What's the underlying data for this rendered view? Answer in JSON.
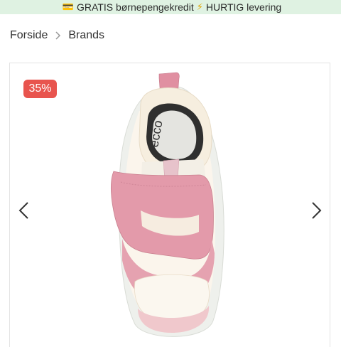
{
  "promo": {
    "card_icon": "💳",
    "text1": "GRATIS børnepengekredit",
    "bolt_icon": "⚡",
    "text2": "HURTIG levering"
  },
  "breadcrumb": {
    "items": [
      {
        "label": "Forside"
      },
      {
        "label": "Brands"
      }
    ]
  },
  "product": {
    "discount_badge": "35%",
    "image": {
      "brand_on_insole": "ecco",
      "colors": {
        "pink": "#e7a0ad",
        "cream": "#fbf5ec",
        "sole": "#eef0ec",
        "insole": "#2f2f2f"
      }
    }
  },
  "icons": {
    "prev": "chevron-left-icon",
    "next": "chevron-right-icon",
    "separator": "chevron-right-icon"
  }
}
